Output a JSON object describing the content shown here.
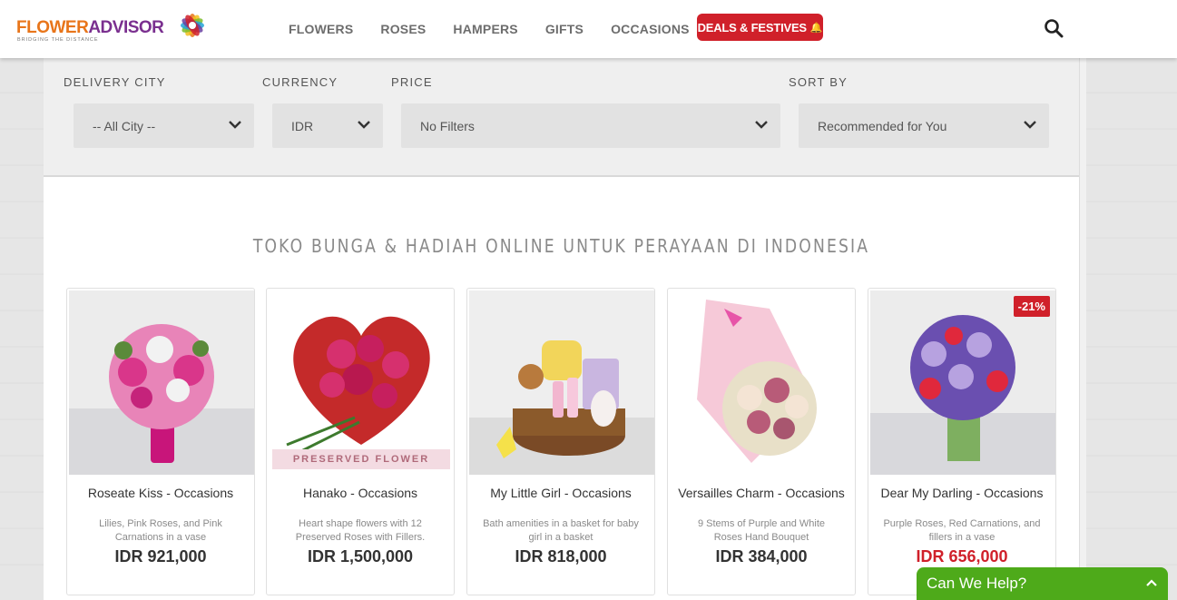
{
  "brand": {
    "name_part1": "FLOWER",
    "name_part2": "ADVISOR",
    "tagline": "BRIDGING THE DISTANCE"
  },
  "nav": {
    "items": [
      "FLOWERS",
      "ROSES",
      "HAMPERS",
      "GIFTS",
      "OCCASIONS"
    ],
    "deals_label": "DEALS & FESTIVES",
    "deals_icon": "bell-icon",
    "search_icon": "search-icon"
  },
  "filters": {
    "delivery_city": {
      "label": "DELIVERY CITY",
      "value": "-- All City --"
    },
    "currency": {
      "label": "CURRENCY",
      "value": "IDR"
    },
    "price": {
      "label": "PRICE",
      "value": "No Filters"
    },
    "sort_by": {
      "label": "SORT BY",
      "value": "Recommended for You"
    }
  },
  "page_title": "TOKO BUNGA & HADIAH ONLINE UNTUK PERAYAAN DI INDONESIA",
  "products": [
    {
      "name": "Roseate Kiss - Occasions",
      "desc": "Lilies, Pink Roses, and Pink Carnations in a vase",
      "price": "IDR 921,000"
    },
    {
      "name": "Hanako - Occasions",
      "desc": "Heart shape flowers with 12 Preserved Roses with Fillers. This...",
      "price": "IDR 1,500,000",
      "banner": "PRESERVED FLOWER"
    },
    {
      "name": "My Little Girl - Occasions",
      "desc": "Bath amenities in a basket for baby girl in a basket",
      "price": "IDR 818,000"
    },
    {
      "name": "Versailles Charm - Occasions",
      "desc": "9 Stems of Purple and White Roses Hand Bouquet",
      "price": "IDR 384,000"
    },
    {
      "name": "Dear My Darling - Occasions",
      "desc": "Purple Roses, Red Carnations, and fillers in a vase",
      "price": "IDR 656,000",
      "discount": "-21%"
    }
  ],
  "help_widget": {
    "label": "Can We Help?"
  },
  "colors": {
    "accent_red": "#d0202a",
    "help_green": "#4eaa1a",
    "brand_orange": "#e8751a",
    "brand_purple": "#7a2f8f"
  }
}
